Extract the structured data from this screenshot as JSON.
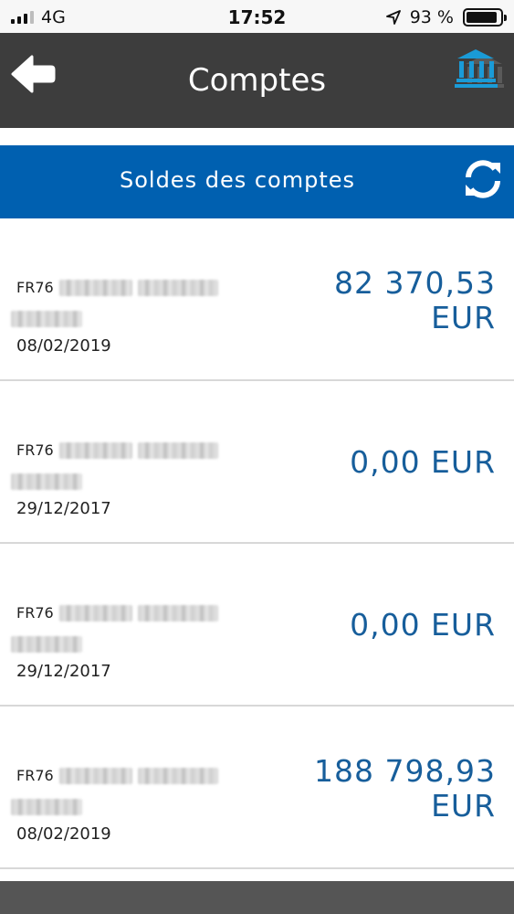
{
  "status_bar": {
    "carrier": "4G",
    "time": "17:52",
    "battery_text": "93 %",
    "battery_level": 0.93,
    "icons": [
      "signal-icon",
      "location-arrow-icon",
      "battery-icon"
    ]
  },
  "header": {
    "title": "Comptes",
    "back_icon": "back-arrow-icon",
    "bank_icon": "bank-icon",
    "colors": {
      "background": "#3d3d3d",
      "bank_icon": "#1a9bd7"
    }
  },
  "section": {
    "title": "Soldes des comptes",
    "refresh_icon": "refresh-icon",
    "colors": {
      "background": "#0060b0"
    }
  },
  "accounts": [
    {
      "iban_prefix": "FR76",
      "date": "08/02/2019",
      "amount_line1": "82 370,53",
      "amount_line2": "EUR"
    },
    {
      "iban_prefix": "FR76",
      "date": "29/12/2017",
      "amount_line1": "0,00 EUR",
      "amount_line2": ""
    },
    {
      "iban_prefix": "FR76",
      "date": "29/12/2017",
      "amount_line1": "0,00 EUR",
      "amount_line2": ""
    },
    {
      "iban_prefix": "FR76",
      "date": "08/02/2019",
      "amount_line1": "188 798,93",
      "amount_line2": "EUR"
    }
  ],
  "colors": {
    "amount": "#175e9b"
  }
}
